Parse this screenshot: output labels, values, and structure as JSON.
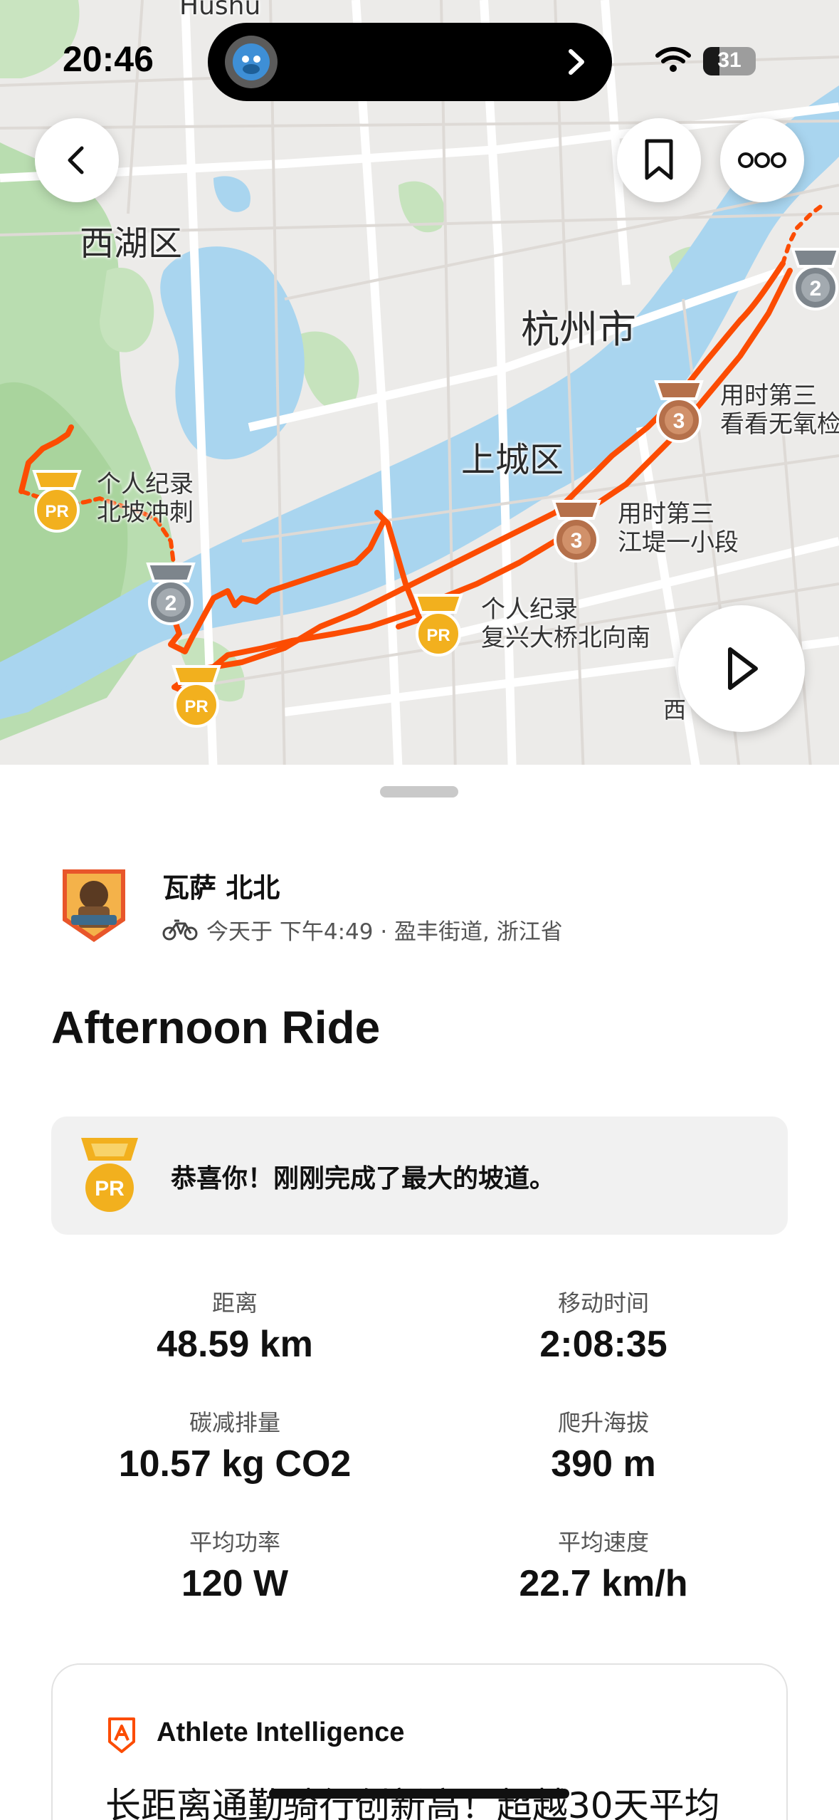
{
  "status_bar": {
    "time": "20:46",
    "battery": "31",
    "battery_level": 0.31
  },
  "map": {
    "labels": {
      "top_edge": "Hushu",
      "district_xihu": "西湖区",
      "city_hangzhou": "杭州市",
      "district_shangcheng": "上城区",
      "partial_bottom": "西"
    },
    "segments": [
      {
        "line1": "用时第三",
        "line2": "看看无氧检",
        "medal": "3"
      },
      {
        "line1": "用时第三",
        "line2": "江堤一小段",
        "medal": "3"
      },
      {
        "line1": "个人纪录",
        "line2": "北坡冲刺",
        "medal": "PR"
      },
      {
        "line1": "个人纪录",
        "line2": "复兴大桥北向南",
        "medal": "PR"
      }
    ],
    "medals_unlabeled": [
      "2",
      "2",
      "PR"
    ],
    "route_color": "#fc4c02"
  },
  "buttons": {
    "back": "chevron-left-icon",
    "bookmark": "bookmark-icon",
    "more": "more-options-icon",
    "play": "play-icon"
  },
  "athlete": {
    "name": "瓦萨 北北",
    "meta": "今天于 下午4:49 · 盈丰街道, 浙江省",
    "sport_icon": "bike-icon"
  },
  "activity": {
    "title": "Afternoon Ride"
  },
  "pr_banner": {
    "badge": "PR",
    "text": "恭喜你！刚刚完成了最大的坡道。"
  },
  "stats": [
    {
      "label": "距离",
      "value": "48.59 km"
    },
    {
      "label": "移动时间",
      "value": "2:08:35"
    },
    {
      "label": "碳减排量",
      "value": "10.57 kg CO2"
    },
    {
      "label": "爬升海拔",
      "value": "390 m"
    },
    {
      "label": "平均功率",
      "value": "120 W"
    },
    {
      "label": "平均速度",
      "value": "22.7 km/h"
    }
  ],
  "athlete_intelligence": {
    "title": "Athlete Intelligence",
    "body": "长距离通勤骑行创新高！超越30天平均"
  },
  "colors": {
    "accent": "#fc4c02",
    "gold_medal": "#f2b01e",
    "bronze_medal": "#b5704a",
    "silver_medal": "#7d858c",
    "water": "#a9d5ef",
    "park": "#b9ddb0"
  }
}
